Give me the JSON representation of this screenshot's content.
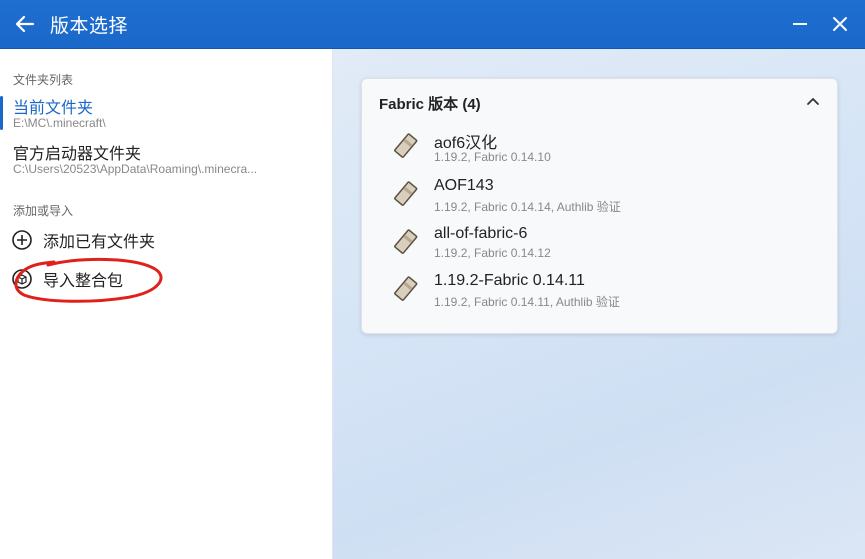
{
  "titlebar": {
    "title": "版本选择",
    "back_icon": "arrow-left-icon",
    "minimize_icon": "minimize-icon",
    "close_icon": "close-icon"
  },
  "sidebar": {
    "folders_section_title": "文件夹列表",
    "folders": [
      {
        "name": "当前文件夹",
        "path": "E:\\MC\\.minecraft\\",
        "selected": true
      },
      {
        "name": "官方启动器文件夹",
        "path": "C:\\Users\\20523\\AppData\\Roaming\\.minecra...",
        "selected": false
      }
    ],
    "add_section_title": "添加或导入",
    "actions": [
      {
        "label": "添加已有文件夹",
        "icon": "plus-circle-icon"
      },
      {
        "label": "导入整合包",
        "icon": "package-icon"
      }
    ]
  },
  "main": {
    "card": {
      "title": "Fabric 版本 (4)",
      "collapse_icon": "chevron-up-icon",
      "versions": [
        {
          "name": "aof6汉化",
          "desc": "1.19.2, Fabric 0.14.10",
          "icon": "fabric-scroll-icon"
        },
        {
          "name": "AOF143",
          "desc": "1.19.2, Fabric 0.14.14, Authlib 验证",
          "icon": "fabric-scroll-icon"
        },
        {
          "name": "all-of-fabric-6",
          "desc": "1.19.2, Fabric 0.14.12",
          "icon": "fabric-scroll-icon"
        },
        {
          "name": "1.19.2-Fabric 0.14.11",
          "desc": "1.19.2, Fabric 0.14.11, Authlib 验证",
          "icon": "fabric-scroll-icon"
        }
      ]
    }
  },
  "colors": {
    "titlebar": "#1a68c9",
    "accent": "#1a68c9",
    "annotation": "#e0201b"
  }
}
